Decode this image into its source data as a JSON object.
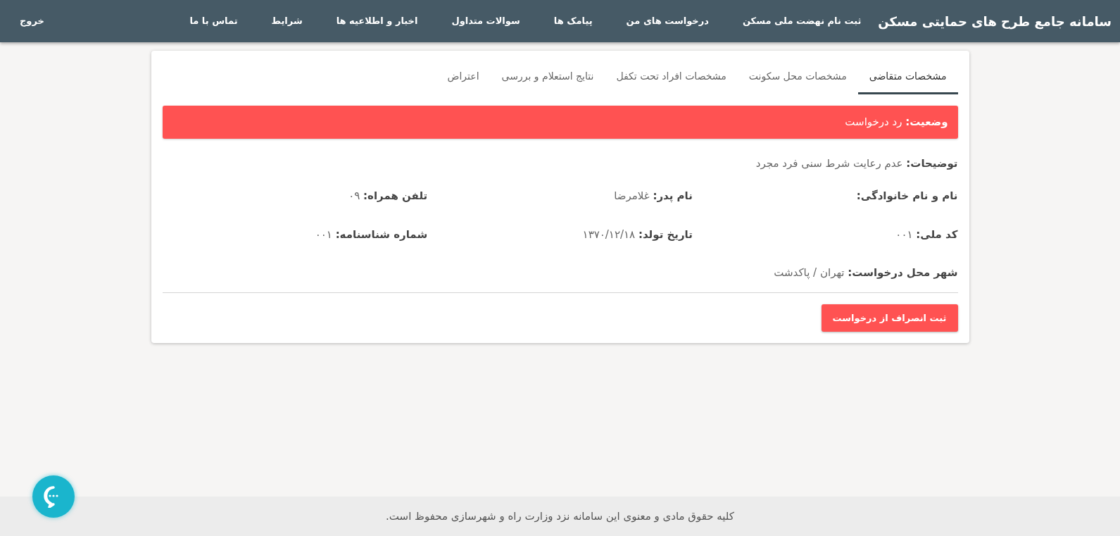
{
  "navbar": {
    "brand": "سامانه جامع طرح های حمایتی مسکن",
    "items": [
      {
        "label": "ثبت نام نهضت ملی مسکن"
      },
      {
        "label": "درخواست های من"
      },
      {
        "label": "پیامک ها"
      },
      {
        "label": "سوالات متداول"
      },
      {
        "label": "اخبار و اطلاعیه ها"
      },
      {
        "label": "شرایط"
      },
      {
        "label": "تماس با ما"
      }
    ],
    "logout": "خروج"
  },
  "tabs": [
    {
      "label": "مشخصات متقاضی",
      "selected": true
    },
    {
      "label": "مشخصات محل سکونت",
      "selected": false
    },
    {
      "label": "مشخصات افراد تحت تکفل",
      "selected": false
    },
    {
      "label": "نتایج استعلام و بررسی",
      "selected": false
    },
    {
      "label": "اعتراض",
      "selected": false
    }
  ],
  "status": {
    "label": "وضعیت:",
    "value": "رد درخواست"
  },
  "description": {
    "label": "توضیحات:",
    "value": "عدم رعایت شرط سنی فرد مجرد"
  },
  "field_rows": [
    [
      {
        "label": "نام و نام خانوادگی:"
      },
      {
        "label": "نام پدر:",
        "value": "غلامرضا"
      },
      {
        "label": "تلفن همراه:",
        "value": "۰۹"
      }
    ],
    [
      {
        "label": "کد ملی:",
        "value": "۰۰۱"
      },
      {
        "label": "تاریخ تولد:",
        "value": "۱۳۷۰/۱۲/۱۸"
      },
      {
        "label": "شماره شناسنامه:",
        "value": "۰۰۱"
      }
    ]
  ],
  "city": {
    "label": "شهر محل درخواست:",
    "value": "تهران / پاکدشت"
  },
  "cancel_button": "ثبت انصراف از درخواست",
  "footer": "کلیه حقوق مادی و معنوی این سامانه نزد وزارت راه و شهرسازی محفوظ است."
}
